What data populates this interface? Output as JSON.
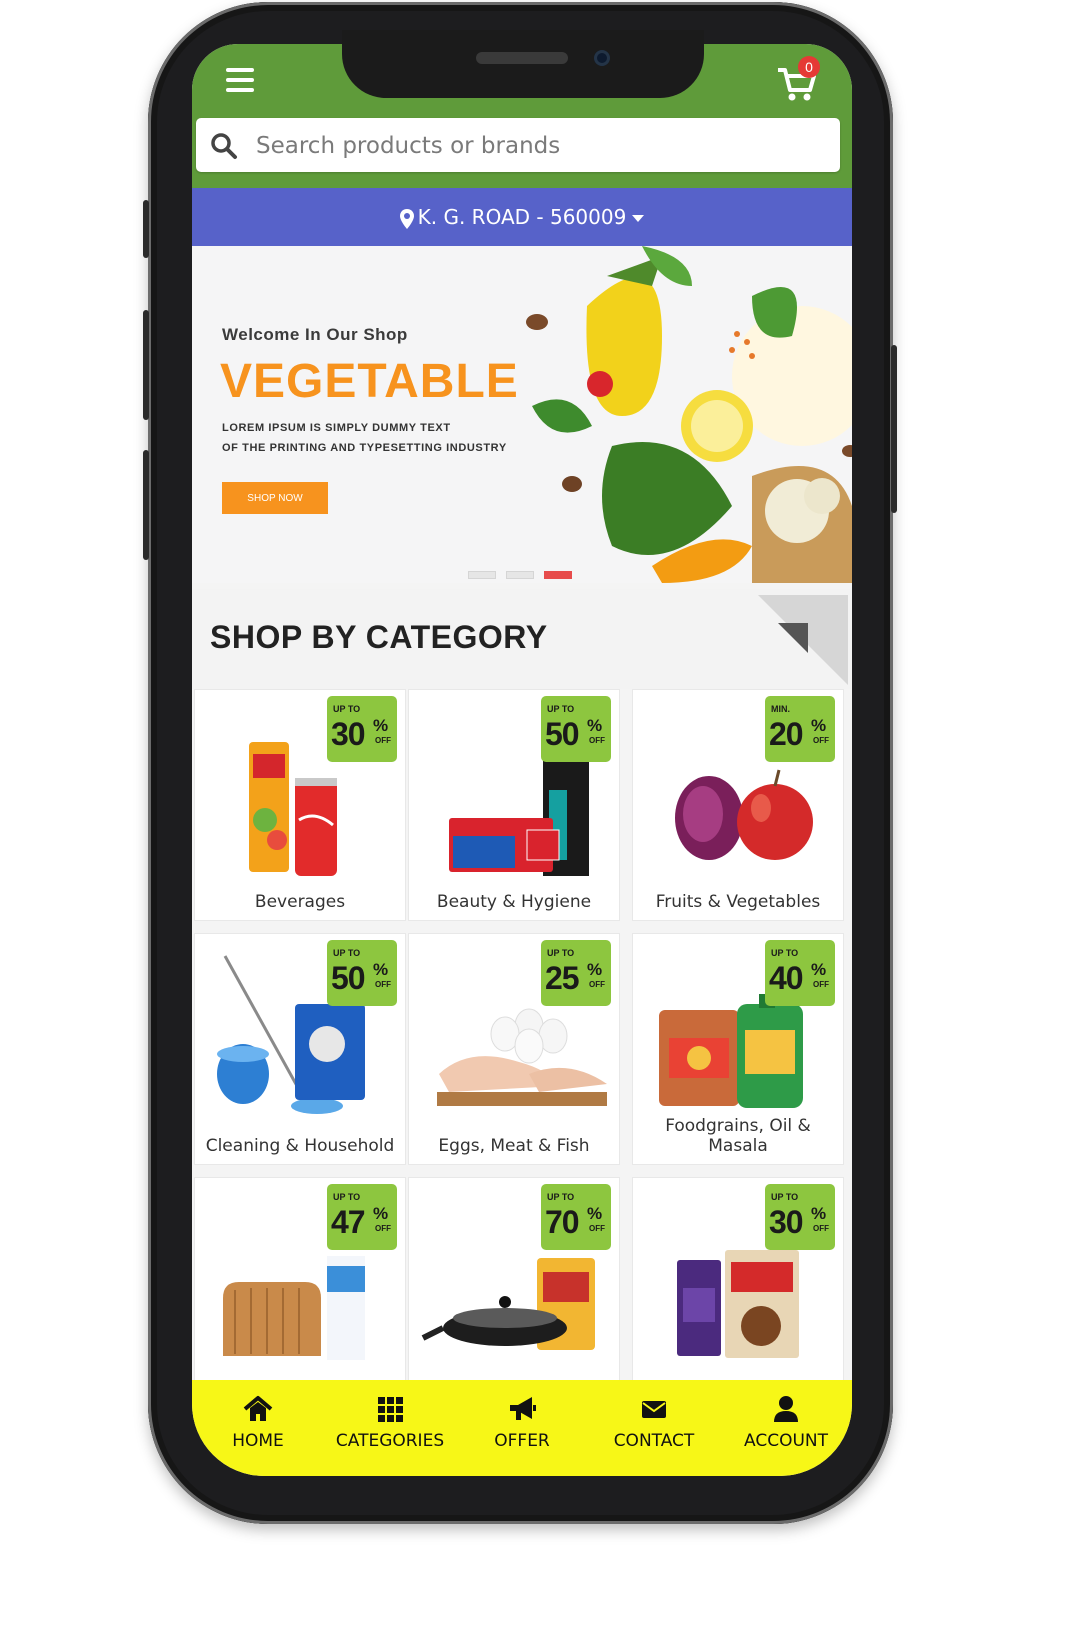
{
  "header": {
    "cart_count": "0"
  },
  "search": {
    "placeholder": "Search products or brands"
  },
  "location": {
    "text": "K. G. ROAD - 560009"
  },
  "hero": {
    "welcome": "Welcome In Our Shop",
    "title": "VEGETABLE",
    "line1": "LOREM IPSUM IS SIMPLY DUMMY TEXT",
    "line2": "OF THE PRINTING AND TYPESETTING INDUSTRY",
    "button": "SHOP NOW",
    "active_slide": 3
  },
  "section": {
    "title": "SHOP BY CATEGORY"
  },
  "categories": [
    {
      "label": "Beverages",
      "prefix": "UP TO",
      "discount": "30",
      "suffix": "OFF"
    },
    {
      "label": "Beauty & Hygiene",
      "prefix": "UP TO",
      "discount": "50",
      "suffix": "OFF"
    },
    {
      "label": "Fruits & Vegetables",
      "prefix": "MIN.",
      "discount": "20",
      "suffix": "OFF"
    },
    {
      "label": "Cleaning & Household",
      "prefix": "UP TO",
      "discount": "50",
      "suffix": "OFF"
    },
    {
      "label": "Eggs, Meat & Fish",
      "prefix": "UP TO",
      "discount": "25",
      "suffix": "OFF"
    },
    {
      "label": "Foodgrains, Oil & Masala",
      "prefix": "UP TO",
      "discount": "40",
      "suffix": "OFF"
    },
    {
      "label": "",
      "prefix": "UP TO",
      "discount": "47",
      "suffix": "OFF"
    },
    {
      "label": "",
      "prefix": "UP TO",
      "discount": "70",
      "suffix": "OFF"
    },
    {
      "label": "",
      "prefix": "UP TO",
      "discount": "30",
      "suffix": "OFF"
    }
  ],
  "nav": [
    "HOME",
    "CATEGORIES",
    "OFFER",
    "CONTACT",
    "ACCOUNT"
  ],
  "colors": {
    "header_green": "#5f9b3a",
    "location_blue": "#5762c9",
    "accent_orange": "#f7931e",
    "tag_green": "#8dc63f",
    "nav_yellow": "#f7f717",
    "badge_red": "#e53935"
  }
}
